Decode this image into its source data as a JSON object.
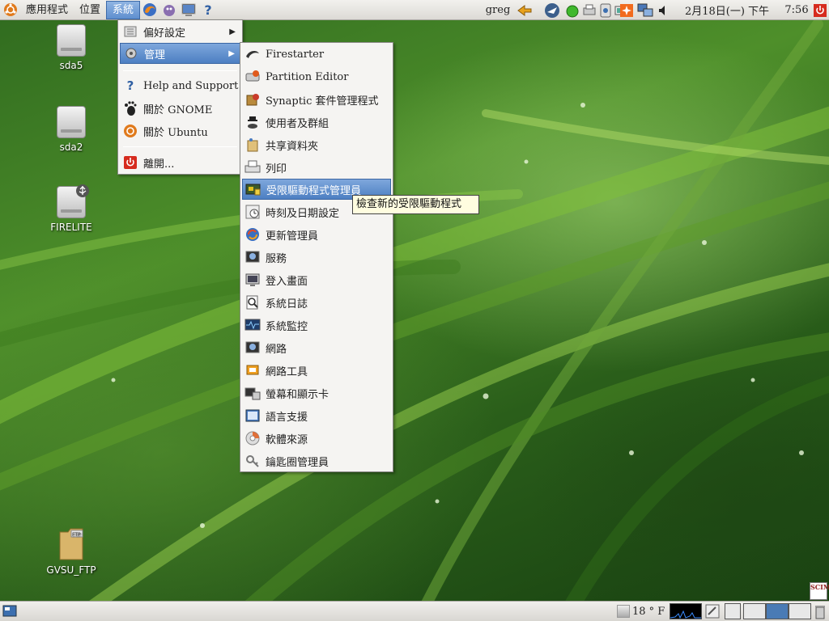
{
  "top_panel": {
    "menus": [
      "應用程式",
      "位置",
      "系統"
    ],
    "active_menu": "系統",
    "user": "greg",
    "date": "2月18日(一) 下午",
    "time": "7:56",
    "launchers": [
      "firefox-icon",
      "pidgin-icon",
      "terminal-icon",
      "help-icon"
    ],
    "help_glyph": "?"
  },
  "desktop_icons": [
    {
      "label": "sda5",
      "icon": "drive-icon"
    },
    {
      "label": "sda2",
      "icon": "drive-icon"
    },
    {
      "label": "FIRELITE",
      "icon": "usb-drive-icon"
    },
    {
      "label": "GVSU_FTP",
      "icon": "ftp-folder-icon"
    }
  ],
  "system_menu": {
    "items": [
      {
        "label": "偏好設定",
        "icon": "preferences-icon",
        "submenu": true
      },
      {
        "label": "管理",
        "icon": "administration-icon",
        "submenu": true,
        "highlighted": true
      },
      {
        "label": "Help and Support",
        "icon": "help-icon"
      },
      {
        "label": "關於 GNOME",
        "icon": "gnome-foot-icon"
      },
      {
        "label": "關於 Ubuntu",
        "icon": "ubuntu-icon"
      },
      {
        "label": "離開...",
        "icon": "shutdown-icon"
      }
    ]
  },
  "admin_menu": {
    "items": [
      {
        "label": "Firestarter",
        "icon": "firestarter-icon"
      },
      {
        "label": "Partition Editor",
        "icon": "partition-icon"
      },
      {
        "label": "Synaptic 套件管理程式",
        "icon": "synaptic-icon"
      },
      {
        "label": "使用者及群組",
        "icon": "users-icon"
      },
      {
        "label": "共享資料夾",
        "icon": "shared-folder-icon"
      },
      {
        "label": "列印",
        "icon": "printer-icon"
      },
      {
        "label": "受限驅動程式管理員",
        "icon": "restricted-drivers-icon",
        "highlighted": true
      },
      {
        "label": "時刻及日期設定",
        "icon": "clock-icon"
      },
      {
        "label": "更新管理員",
        "icon": "update-icon"
      },
      {
        "label": "服務",
        "icon": "services-icon"
      },
      {
        "label": "登入畫面",
        "icon": "login-screen-icon"
      },
      {
        "label": "系統日誌",
        "icon": "log-viewer-icon"
      },
      {
        "label": "系統監控",
        "icon": "system-monitor-icon"
      },
      {
        "label": "網路",
        "icon": "network-icon"
      },
      {
        "label": "網路工具",
        "icon": "network-tools-icon"
      },
      {
        "label": "螢幕和顯示卡",
        "icon": "display-icon"
      },
      {
        "label": "語言支援",
        "icon": "language-icon"
      },
      {
        "label": "軟體來源",
        "icon": "software-sources-icon"
      },
      {
        "label": "鑰匙圈管理員",
        "icon": "keyring-icon"
      }
    ]
  },
  "tooltip": "檢查新的受限驅動程式",
  "bottom_panel": {
    "temperature": "18 ° F",
    "scim_label": "SCIM"
  },
  "colors": {
    "highlight": "#5f8fcf",
    "panel": "#dcdad5",
    "tooltip_bg": "#fffde0"
  }
}
